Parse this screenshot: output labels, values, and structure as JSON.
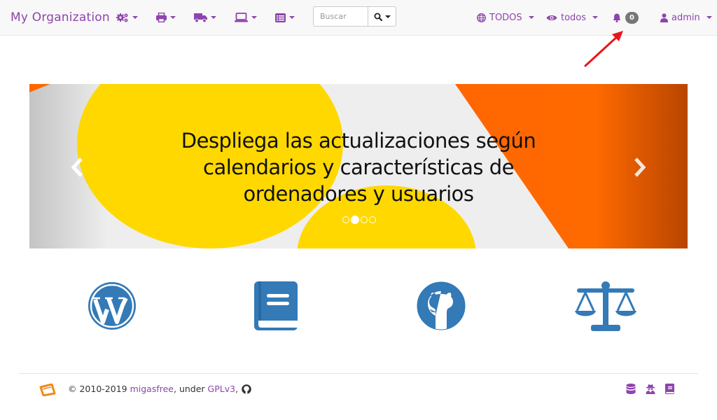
{
  "navbar": {
    "brand": "My Organization",
    "menus": [
      {
        "icon": "cogs-icon"
      },
      {
        "icon": "print-icon"
      },
      {
        "icon": "truck-icon"
      },
      {
        "icon": "laptop-icon"
      },
      {
        "icon": "list-icon"
      }
    ],
    "search": {
      "placeholder": "Buscar",
      "value": ""
    },
    "scope": {
      "label": "TODOS",
      "icon": "globe-icon"
    },
    "view": {
      "label": "todos",
      "icon": "eye-icon"
    },
    "alerts": {
      "count": "0",
      "icon": "bell-icon"
    },
    "user": {
      "label": "admin",
      "icon": "user-icon"
    }
  },
  "carousel": {
    "caption_lines": [
      "Despliega las actualizaciones según",
      "calendarios y características de",
      "ordenadores y usuarios"
    ],
    "slides": 4,
    "active_slide": 2,
    "colors": {
      "yellow": "#ffd800",
      "orange": "#ff6600",
      "bg": "#eeeeee"
    }
  },
  "links": [
    {
      "icon": "wordpress-icon"
    },
    {
      "icon": "book-icon"
    },
    {
      "icon": "github-icon"
    },
    {
      "icon": "balance-scale-icon"
    }
  ],
  "footer": {
    "copyright_prefix": "© 2010-2019 ",
    "project": "migasfree",
    "under": ", under ",
    "license": "GPLv3",
    "suffix": ","
  },
  "colors": {
    "accent": "#8e44ad",
    "icon_blue": "#337ab7",
    "badge": "#777777",
    "arrow": "#e8161c"
  }
}
